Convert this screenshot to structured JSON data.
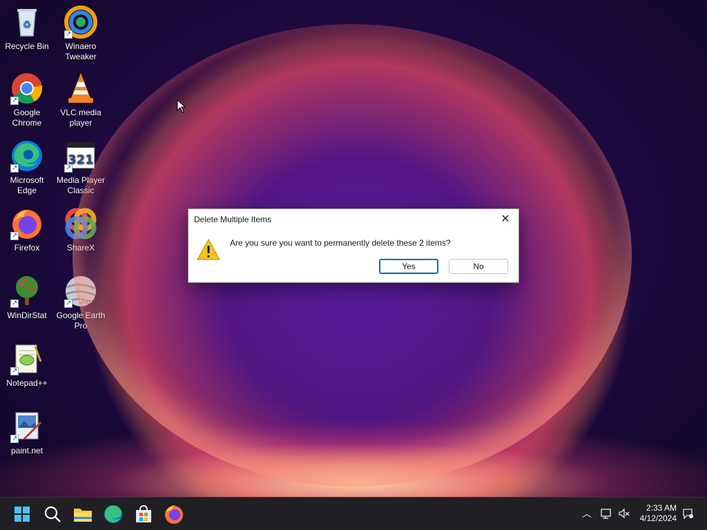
{
  "desktop_icons": [
    {
      "label": "Recycle Bin",
      "icon": "recycle-bin-icon"
    },
    {
      "label": "Winaero\nTweaker",
      "icon": "winaero-tweaker-icon"
    },
    {
      "label": "Google\nChrome",
      "icon": "chrome-icon"
    },
    {
      "label": "VLC media\nplayer",
      "icon": "vlc-icon"
    },
    {
      "label": "Microsoft\nEdge",
      "icon": "edge-icon"
    },
    {
      "label": "Media Player\nClassic",
      "icon": "media-player-classic-icon"
    },
    {
      "label": "Firefox",
      "icon": "firefox-icon"
    },
    {
      "label": "ShareX",
      "icon": "sharex-icon"
    },
    {
      "label": "WinDirStat",
      "icon": "windirstat-icon"
    },
    {
      "label": "Google Earth\nPro",
      "icon": "google-earth-pro-icon"
    },
    {
      "label": "Notepad++",
      "icon": "notepad-plus-plus-icon"
    },
    {
      "label": "paint.net",
      "icon": "paint-net-icon"
    }
  ],
  "google_earth_badge": "Pro",
  "dialog": {
    "title": "Delete Multiple Items",
    "close_glyph": "✕",
    "message": "Are you sure you want to permanently delete these 2 items?",
    "yes_label": "Yes",
    "no_label": "No"
  },
  "taskbar": {
    "apps": [
      "start-icon",
      "search-icon",
      "file-explorer-icon",
      "edge-icon",
      "microsoft-store-icon",
      "firefox-icon"
    ],
    "tray": {
      "chevron_glyph": "︿",
      "time": "2:33 AM",
      "date": "4/12/2024"
    }
  },
  "colors": {
    "accent": "#0067c0",
    "taskbar": "#1f1f24",
    "dialog_bg": "#ffffff"
  }
}
